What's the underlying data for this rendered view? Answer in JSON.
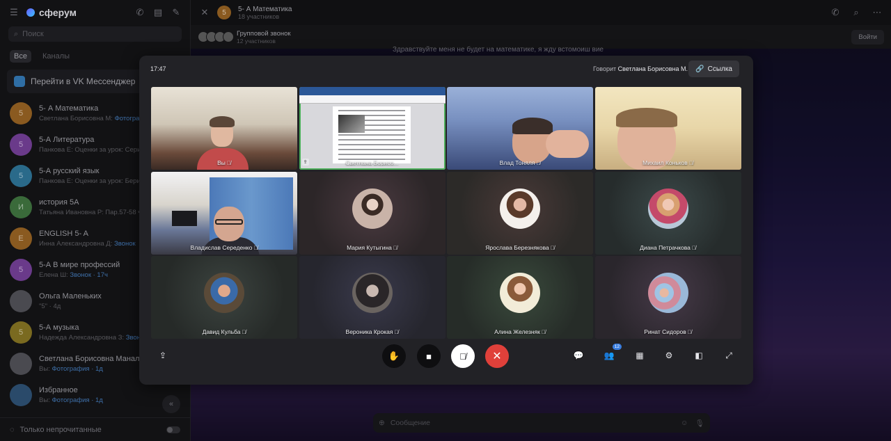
{
  "sidebar": {
    "brand": "сферум",
    "search_placeholder": "Поиск",
    "filters": [
      "Все",
      "Каналы"
    ],
    "vk_banner": "Перейти в VK Мессенджер",
    "chats": [
      {
        "initial": "5",
        "name": "5- А Математика",
        "sub_prefix": "Светлана Борисовна М: ",
        "sub_hl": "Фотографи",
        "color": "#8a5a20"
      },
      {
        "initial": "5",
        "name": "5-А Литература",
        "sub_prefix": "Панкова Е: Оценки за урок: Сери",
        "sub_hl": "",
        "color": "#6a3a8a"
      },
      {
        "initial": "5",
        "name": "5-А русский язык",
        "sub_prefix": "Панкова Е: Оценки за урок: Бери",
        "sub_hl": "",
        "color": "#2a6a8a"
      },
      {
        "initial": "И",
        "name": "история 5А",
        "sub_prefix": "Татьяна Ивановна Р: Пар.57-58 чи",
        "sub_hl": "",
        "color": "#3a6a3a"
      },
      {
        "initial": "E",
        "name": "ENGLISH 5- A",
        "sub_prefix": "Инна Александровна Д: ",
        "sub_hl": "Звонок",
        "color": "#8a5a20"
      },
      {
        "initial": "5",
        "name": "5-А В мире профессий",
        "sub_prefix": "Елена Ш: ",
        "sub_hl": "Звонок · 17ч",
        "color": "#6a3a8a"
      },
      {
        "initial": "",
        "name": "Ольга Маленьких",
        "sub_prefix": "\"5\" · 4д",
        "sub_hl": "",
        "color": "#4a4a50"
      },
      {
        "initial": "5",
        "name": "5-А музыка",
        "sub_prefix": "Надежда Александровна З: ",
        "sub_hl": "Звон",
        "color": "#7a6a20"
      },
      {
        "initial": "",
        "name": "Светлана Борисовна Маналатий",
        "sub_prefix": "Вы: ",
        "sub_hl": "Фотография · 1д",
        "color": "#4a4a50"
      },
      {
        "initial": "",
        "name": "Избранное",
        "sub_prefix": "Вы: ",
        "sub_hl": "Фотография · 1д",
        "color": "#2a4a6a"
      }
    ],
    "unread_only": "Только непрочитанные"
  },
  "chat_header": {
    "title": "5- А Математика",
    "subtitle": "18 участников",
    "initial": "5"
  },
  "call_strip": {
    "title": "Групповой звонок",
    "subtitle": "12 участников",
    "join_label": "Войти"
  },
  "message_preview": "Здравствуйте меня не будет на математике, я жду встомоиш вие",
  "compose_placeholder": "Сообщение",
  "call": {
    "time": "17:47",
    "speaking_prefix": "Говорит ",
    "speaking_name": "Светлана Борисовна М.",
    "link_label": "Ссылка",
    "participants_count": "12",
    "tiles": [
      {
        "name": "Вы"
      },
      {
        "name": "Светлана Борисо..."
      },
      {
        "name": "Влад Тоняля"
      },
      {
        "name": "Михаил Коньков"
      },
      {
        "name": "Владислав Середенко"
      },
      {
        "name": "Мария Кутыгина"
      },
      {
        "name": "Ярослава Березнякова"
      },
      {
        "name": "Диана Петрачкова"
      },
      {
        "name": "Давид Кульба"
      },
      {
        "name": "Вероника Крокая"
      },
      {
        "name": "Алина Железняк"
      },
      {
        "name": "Ринат Сидоров"
      }
    ]
  },
  "colors": {
    "speaking_outline": "#4cae5a",
    "end_call": "#e0403a",
    "badge": "#3b7fe0"
  }
}
